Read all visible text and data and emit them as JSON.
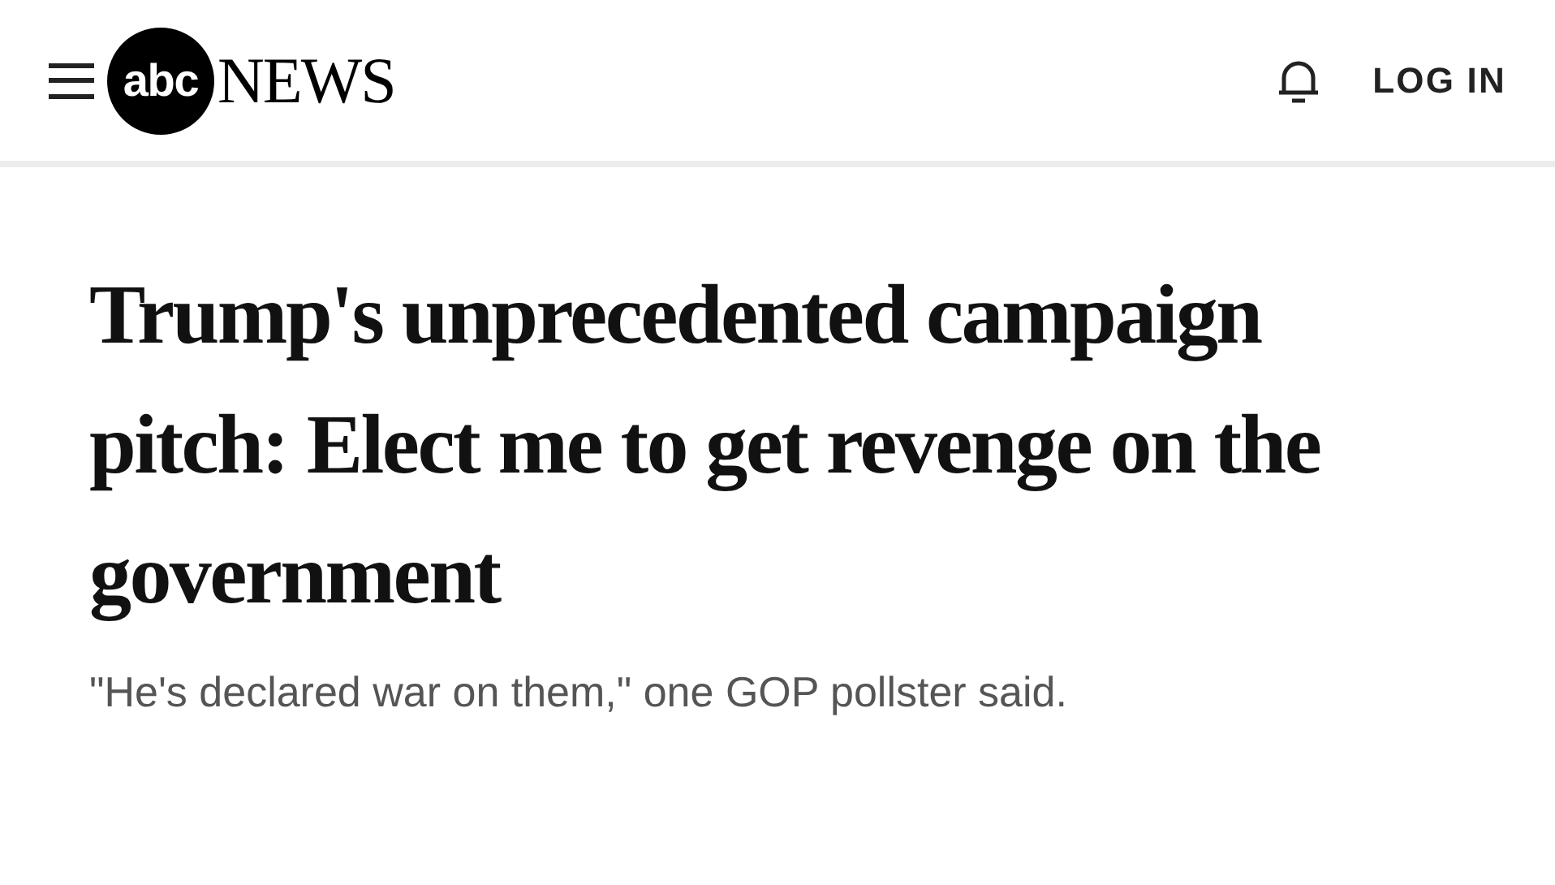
{
  "header": {
    "logo": {
      "mark": "abc",
      "word": "NEWS"
    },
    "login": "LOG IN"
  },
  "article": {
    "headline": "Trump's unprecedented campaign pitch: Elect me to get revenge on the government",
    "subheadline": "\"He's declared war on them,\" one GOP pollster said."
  }
}
